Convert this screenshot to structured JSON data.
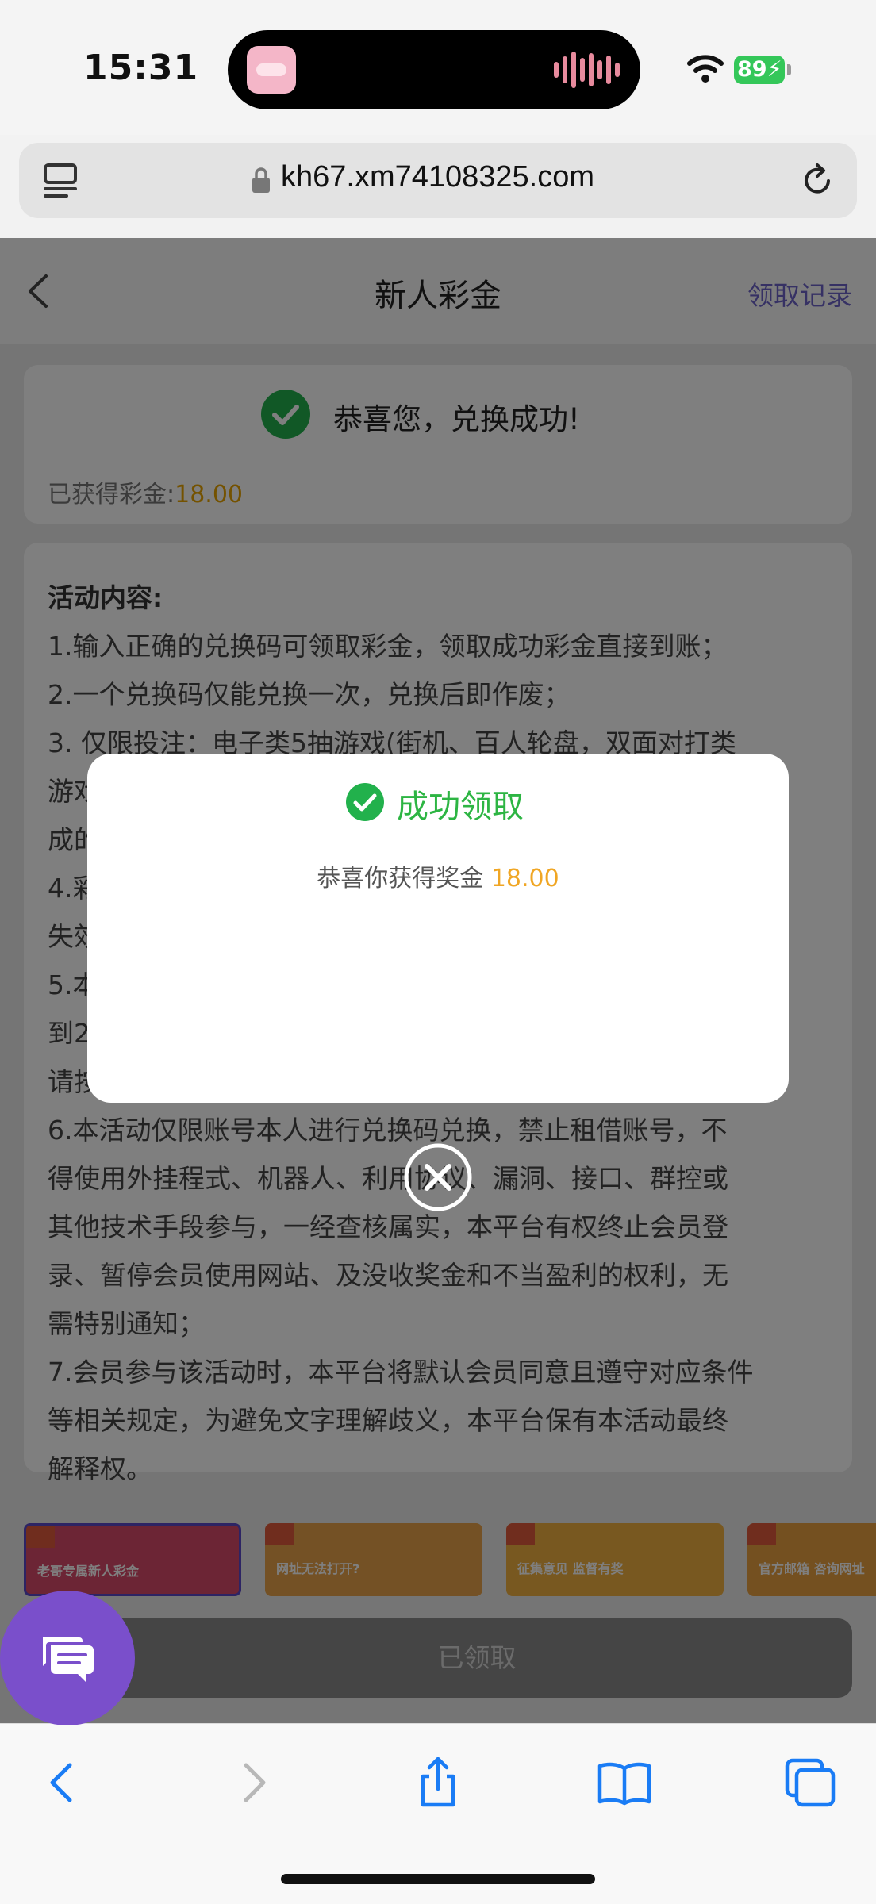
{
  "status_bar": {
    "time": "15:31",
    "battery": "89"
  },
  "browser": {
    "url": "kh67.xm74108325.com"
  },
  "nav": {
    "title": "新人彩金",
    "record_link": "领取记录"
  },
  "result_card": {
    "title": "恭喜您，兑换成功!",
    "earned_label": "已获得彩金:",
    "earned_value": "18.00"
  },
  "rules": {
    "title": "活动内容:",
    "lines": [
      "1.输入正确的兑换码可领取彩金，领取成功彩金直接到账；",
      "2.一个兑换码仅能兑换一次，兑换后即作废；",
      "3. 仅限投注：电子类5抽游戏(街机、百人轮盘，双面对打类",
      "游戏",
      "成的",
      "4.彩",
      "失效",
      "5.本",
      "到2",
      "请按",
      "6.本活动仅限账号本人进行兑换码兑换，禁止租借账号，不",
      "得使用外挂程式、机器人、利用协议、漏洞、接口、群控或",
      "其他技术手段参与，一经查核属实，本平台有权终止会员登",
      "录、暂停会员使用网站、及没收奖金和不当盈利的权利，无",
      "需特别通知；",
      "7.会员参与该活动时，本平台将默认会员同意且遵守对应条件",
      "等相关规定，为避免文字理解歧义，本平台保有本活动最终",
      "解释权。"
    ]
  },
  "banners": [
    {
      "text": "老哥专属新人彩金",
      "color": "#d94b6a"
    },
    {
      "text": "网址无法打开?",
      "color": "#e9a24a"
    },
    {
      "text": "征集意见 监督有奖",
      "color": "#f0b040"
    },
    {
      "text": "官方邮箱 咨询网址",
      "color": "#e8a040"
    }
  ],
  "claimed_button": "已领取",
  "modal": {
    "title": "成功领取",
    "message_prefix": "恭喜你获得奖金 ",
    "amount": "18.00"
  },
  "colors": {
    "accent_green": "#2db543",
    "amount_orange": "#f0a624",
    "link_purple": "#6d63c9",
    "chat_purple": "#7a4fcb"
  },
  "icons": {
    "toolbar": [
      "back-icon",
      "forward-icon",
      "share-icon",
      "bookmarks-icon",
      "tabs-icon"
    ]
  }
}
